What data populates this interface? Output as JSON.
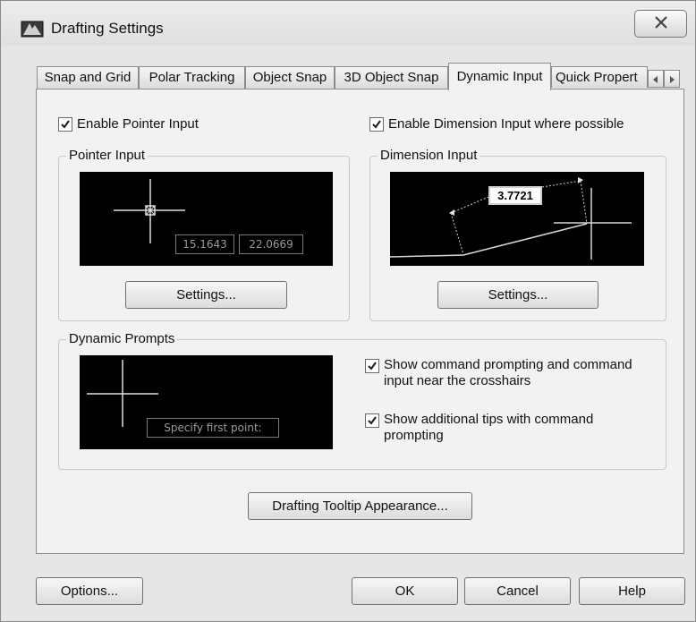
{
  "window": {
    "title": "Drafting Settings"
  },
  "tabs": [
    {
      "label": "Snap and Grid"
    },
    {
      "label": "Polar Tracking"
    },
    {
      "label": "Object Snap"
    },
    {
      "label": "3D Object Snap"
    },
    {
      "label": "Dynamic Input",
      "active": true
    },
    {
      "label": "Quick Propert"
    }
  ],
  "dynamic_input": {
    "enable_pointer_input": {
      "label": "Enable Pointer Input",
      "checked": true
    },
    "enable_dimension_input": {
      "label": "Enable Dimension Input where possible",
      "checked": true
    },
    "pointer_input": {
      "group_label": "Pointer Input",
      "preview_x": "15.1643",
      "preview_y": "22.0669",
      "settings_label": "Settings..."
    },
    "dimension_input": {
      "group_label": "Dimension Input",
      "preview_value": "3.7721",
      "settings_label": "Settings..."
    },
    "dynamic_prompts": {
      "group_label": "Dynamic Prompts",
      "preview_prompt": "Specify first point:",
      "show_command_prompting": {
        "label_line1": "Show command prompting and command",
        "label_line2": "input near the crosshairs",
        "checked": true
      },
      "show_additional_tips": {
        "label_line1": "Show additional tips with command",
        "label_line2": "prompting",
        "checked": true
      }
    },
    "tooltip_appearance_label": "Drafting Tooltip Appearance..."
  },
  "footer": {
    "options_label": "Options...",
    "ok_label": "OK",
    "cancel_label": "Cancel",
    "help_label": "Help"
  },
  "colors": {
    "dialog_bg": "#e6e6e6",
    "panel_bg": "#f2f2f2",
    "preview_bg": "#000000",
    "preview_text": "#9a9a9a",
    "crosshair": "#e0e0e0"
  },
  "icons": {
    "app": "drafting-app-icon",
    "close": "close-icon",
    "check": "checkmark-icon",
    "tab_left": "chevron-left-icon",
    "tab_right": "chevron-right-icon"
  }
}
